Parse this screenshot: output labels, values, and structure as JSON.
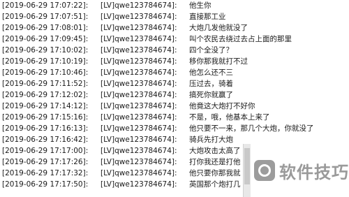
{
  "log": {
    "rows": [
      {
        "time": "[2019-06-29 17:07:22]:",
        "user": "[LV]qwe123784674]:",
        "msg": "他生你"
      },
      {
        "time": "[2019-06-29 17:07:51]:",
        "user": "[LV]qwe123784674]:",
        "msg": "直接那工业"
      },
      {
        "time": "[2019-06-29 17:08:01]:",
        "user": "[LV]qwe123784674]:",
        "msg": "大炮几发他就没了"
      },
      {
        "time": "[2019-06-29 17:09:45]:",
        "user": "[LV]qwe123784674]:",
        "msg": "叫个农民去绕过去占上面的那里"
      },
      {
        "time": "[2019-06-29 17:10:02]:",
        "user": "[LV]qwe123784674]:",
        "msg": "四个全没了？"
      },
      {
        "time": "[2019-06-29 17:10:19]:",
        "user": "[LV]qwe123784674]:",
        "msg": "移你那我就打不过"
      },
      {
        "time": "[2019-06-29 17:10:46]:",
        "user": "[LV]qwe123784674]:",
        "msg": "他怎么还不三"
      },
      {
        "time": "[2019-06-29 17:11:52]:",
        "user": "[LV]qwe123784674]:",
        "msg": "压过去，骑着"
      },
      {
        "time": "[2019-06-29 17:12:02]:",
        "user": "[LV]qwe123784674]:",
        "msg": "搞死你就赢了"
      },
      {
        "time": "[2019-06-29 17:14:12]:",
        "user": "[LV]qwe123784674]:",
        "msg": "他竟这大炮打不好你"
      },
      {
        "time": "[2019-06-29 17:15:16]:",
        "user": "[LV]qwe123784674]:",
        "msg": "不是，哦，他基本上来了"
      },
      {
        "time": "[2019-06-29 17:16:13]:",
        "user": "[LV]qwe123784674]:",
        "msg": "他只要不一来，那几个大炮，你就没了"
      },
      {
        "time": "[2019-06-29 17:16:42]:",
        "user": "[LV]qwe123784674]:",
        "msg": "骑兵先打大炮"
      },
      {
        "time": "[2019-06-29 17:17:00]:",
        "user": "[LV]qwe123784674]:",
        "msg": "大炮攻击太高了"
      },
      {
        "time": "[2019-06-29 17:17:26]:",
        "user": "[LV]qwe123784674]:",
        "msg": "打你我还是打他"
      },
      {
        "time": "[2019-06-29 17:17:32]:",
        "user": "[LV]qwe123784674]:",
        "msg": "他只要你那我就"
      },
      {
        "time": "[2019-06-29 17:17:50]:",
        "user": "[LV]qwe123784674]:",
        "msg": "英国那个炮打几"
      }
    ]
  },
  "watermark": {
    "icon": "brand-logo-icon",
    "text": "软件技巧"
  },
  "colors": {
    "text": "#1a1a1a",
    "watermark": "#9a9a9a"
  }
}
